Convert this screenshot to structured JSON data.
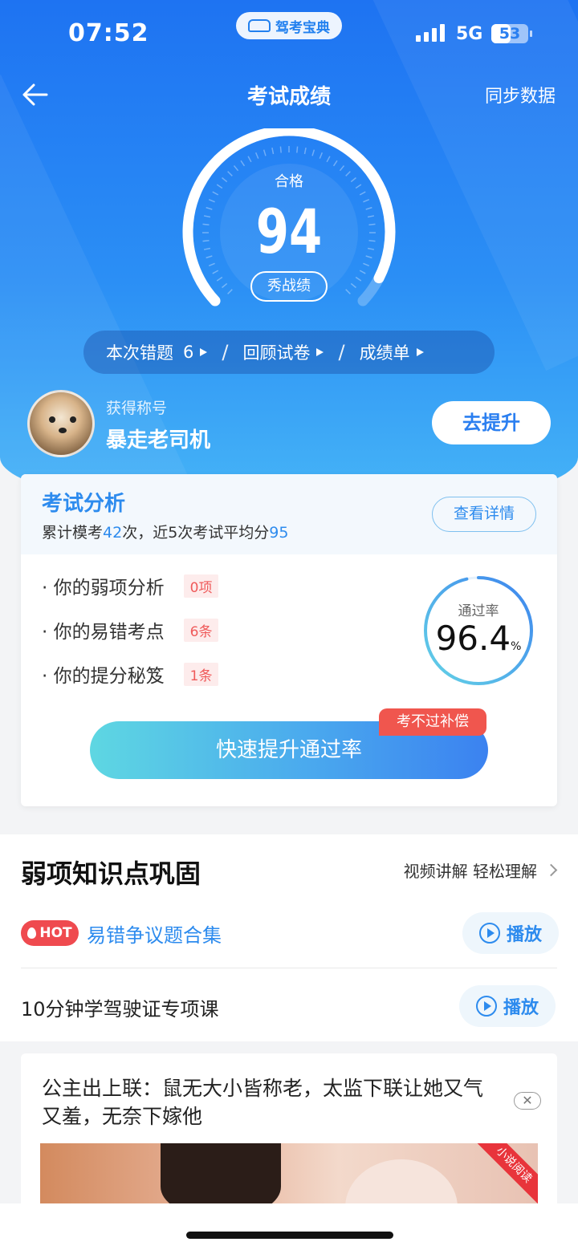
{
  "status": {
    "time": "07:52",
    "app_name": "驾考宝典",
    "network": "5G",
    "battery": "53",
    "battery_level": 0.53
  },
  "nav": {
    "title": "考试成绩",
    "sync_label": "同步数据"
  },
  "score": {
    "status": "合格",
    "value": "94",
    "share_label": "秀战绩",
    "progress": 0.94
  },
  "links": [
    {
      "label": "本次错题",
      "count": "6"
    },
    {
      "label": "回顾试卷"
    },
    {
      "label": "成绩单"
    }
  ],
  "link_separator": "/",
  "profile": {
    "title_label": "获得称号",
    "title_value": "暴走老司机",
    "improve_label": "去提升"
  },
  "analysis": {
    "title": "考试分析",
    "summary_prefix": "累计模考",
    "exam_count": "42",
    "summary_mid": "次，近5次考试平均分",
    "avg_score": "95",
    "detail_label": "查看详情",
    "rows": [
      {
        "label": "· 你的弱项分析",
        "tag": "0项"
      },
      {
        "label": "· 你的易错考点",
        "tag": "6条"
      },
      {
        "label": "· 你的提分秘笈",
        "tag": "1条"
      }
    ],
    "pass_label": "通过率",
    "pass_value": "96.4",
    "pass_unit": "%",
    "pass_fraction": 0.964,
    "boost_label": "快速提升通过率",
    "badge": "考不过补偿"
  },
  "weak": {
    "title": "弱项知识点巩固",
    "more": "视频讲解 轻松理解",
    "hot_badge": "HOT",
    "items": [
      {
        "title": "易错争议题合集",
        "play": "播放"
      },
      {
        "title": "10分钟学驾驶证专项课",
        "play": "播放"
      }
    ]
  },
  "ad": {
    "text": "公主出上联：鼠无大小皆称老，太监下联让她又气又羞，无奈下嫁他",
    "close": "✕",
    "ribbon": "小说阅读"
  },
  "colors": {
    "brand_blue": "#1e73f2",
    "accent_blue": "#2d8bee",
    "tag_red": "#ef5a5a",
    "hot_red": "#ef4a4f"
  }
}
